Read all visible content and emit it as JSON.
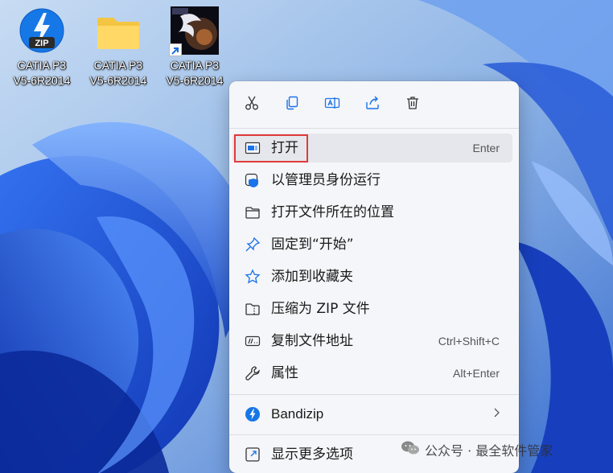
{
  "desktop": {
    "icons": [
      {
        "label_line1": "CATIA P3",
        "label_line2": "V5-6R2014",
        "icon": "zip-archive-icon",
        "badge": "ZIP"
      },
      {
        "label_line1": "CATIA P3",
        "label_line2": "V5-6R2014",
        "icon": "folder-icon"
      },
      {
        "label_line1": "CATIA P3",
        "label_line2": "V5-6R2014",
        "icon": "catia-app-icon"
      }
    ]
  },
  "context_menu": {
    "toolbar": [
      {
        "icon": "cut-icon",
        "tooltip": ""
      },
      {
        "icon": "copy-icon",
        "tooltip": ""
      },
      {
        "icon": "rename-icon",
        "tooltip": ""
      },
      {
        "icon": "share-icon",
        "tooltip": ""
      },
      {
        "icon": "delete-icon",
        "tooltip": ""
      }
    ],
    "items": [
      {
        "label": "打开",
        "shortcut": "Enter",
        "icon": "open-window-icon"
      },
      {
        "label": "以管理员身份运行",
        "shortcut": "",
        "icon": "admin-shield-icon"
      },
      {
        "label": "打开文件所在的位置",
        "shortcut": "",
        "icon": "folder-outline-icon"
      },
      {
        "label": "固定到“开始”",
        "shortcut": "",
        "icon": "pin-icon"
      },
      {
        "label": "添加到收藏夹",
        "shortcut": "",
        "icon": "star-icon"
      },
      {
        "label": "压缩为 ZIP 文件",
        "shortcut": "",
        "icon": "zip-folder-icon"
      },
      {
        "label": "复制文件地址",
        "shortcut": "Ctrl+Shift+C",
        "icon": "copy-path-icon"
      },
      {
        "label": "属性",
        "shortcut": "Alt+Enter",
        "icon": "wrench-icon"
      },
      {
        "label": "Bandizip",
        "shortcut": "",
        "icon": "bandizip-icon",
        "has_submenu": true
      },
      {
        "label": "显示更多选项",
        "shortcut": "",
        "icon": "more-options-icon"
      }
    ]
  },
  "watermark": {
    "text": "公众号 · 最全软件管家"
  },
  "colors": {
    "accent": "#1a73e8",
    "highlight_border": "#e03a3a",
    "menu_bg": "#f5f6f9"
  }
}
